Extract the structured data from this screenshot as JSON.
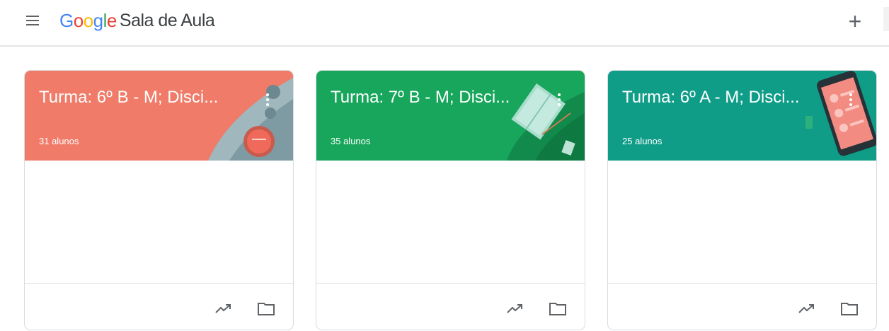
{
  "header": {
    "logo_letters": [
      {
        "char": "G",
        "color": "#4285F4"
      },
      {
        "char": "o",
        "color": "#EA4335"
      },
      {
        "char": "o",
        "color": "#FBBC05"
      },
      {
        "char": "g",
        "color": "#4285F4"
      },
      {
        "char": "l",
        "color": "#34A853"
      },
      {
        "char": "e",
        "color": "#EA4335"
      }
    ],
    "app_name": "Sala de Aula",
    "menu_icon": "hamburger-menu-icon",
    "add_label": "+",
    "add_icon": "plus-icon"
  },
  "classes": [
    {
      "title": "Turma: 6º B - M; Disci...",
      "students": "31 alunos",
      "color": "#EF7B68",
      "illustration": "science-lab-illustration"
    },
    {
      "title": "Turma: 7º B - M; Disci...",
      "students": "35 alunos",
      "color": "#17A65B",
      "illustration": "open-book-illustration"
    },
    {
      "title": "Turma: 6º A - M; Disci...",
      "students": "25 alunos",
      "color": "#0F9D88",
      "illustration": "smartphone-illustration"
    }
  ],
  "card_footer_icons": [
    "trending-up-icon",
    "folder-icon"
  ]
}
